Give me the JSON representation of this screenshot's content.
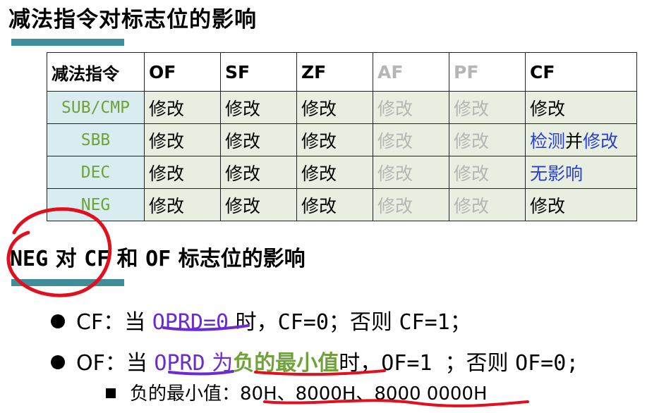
{
  "title1": "减法指令对标志位的影响",
  "table": {
    "headers": [
      "减法指令",
      "OF",
      "SF",
      "ZF",
      "AF",
      "PF",
      "CF"
    ],
    "rows": [
      {
        "instr": "SUB/CMP",
        "cells": [
          "修改",
          "修改",
          "修改",
          "修改",
          "修改"
        ],
        "cf": [
          "修改"
        ]
      },
      {
        "instr": "SBB",
        "cells": [
          "修改",
          "修改",
          "修改",
          "修改",
          "修改"
        ],
        "cf": [
          "检测",
          "并",
          "修改"
        ]
      },
      {
        "instr": "DEC",
        "cells": [
          "修改",
          "修改",
          "修改",
          "修改",
          "修改"
        ],
        "cf": [
          "无影响"
        ]
      },
      {
        "instr": "NEG",
        "cells": [
          "修改",
          "修改",
          "修改",
          "修改",
          "修改"
        ],
        "cf": [
          "修改"
        ]
      }
    ]
  },
  "title2": {
    "part1": "NEG",
    "part2": " 对 ",
    "part3": "CF",
    "part4": " 和 ",
    "part5": "OF",
    "part6": " 标志位的影响"
  },
  "bullet1": {
    "a": "CF：当 ",
    "b": "OPRD=0",
    "c": " 时，",
    "d": "CF=0；",
    "e": "否则 ",
    "f": "CF=1；"
  },
  "bullet2": {
    "a": "OF：当 ",
    "b": "OPRD",
    "c": " 为",
    "d": "负的最小值",
    "e": "时，",
    "f": "OF=1 ；",
    "g": "否则 ",
    "h": "OF=0;"
  },
  "sub": "负的最小值：80H、8000H、8000 0000H",
  "colors": {
    "accent_bar": "#3f8f9b",
    "instr_bg": "#d9ecf0",
    "cell_bg": "#e8efe0",
    "green": "#6fa23a",
    "blue": "#2a3fd1",
    "purple": "#6a2bd0",
    "ink_red": "#e0101e"
  }
}
